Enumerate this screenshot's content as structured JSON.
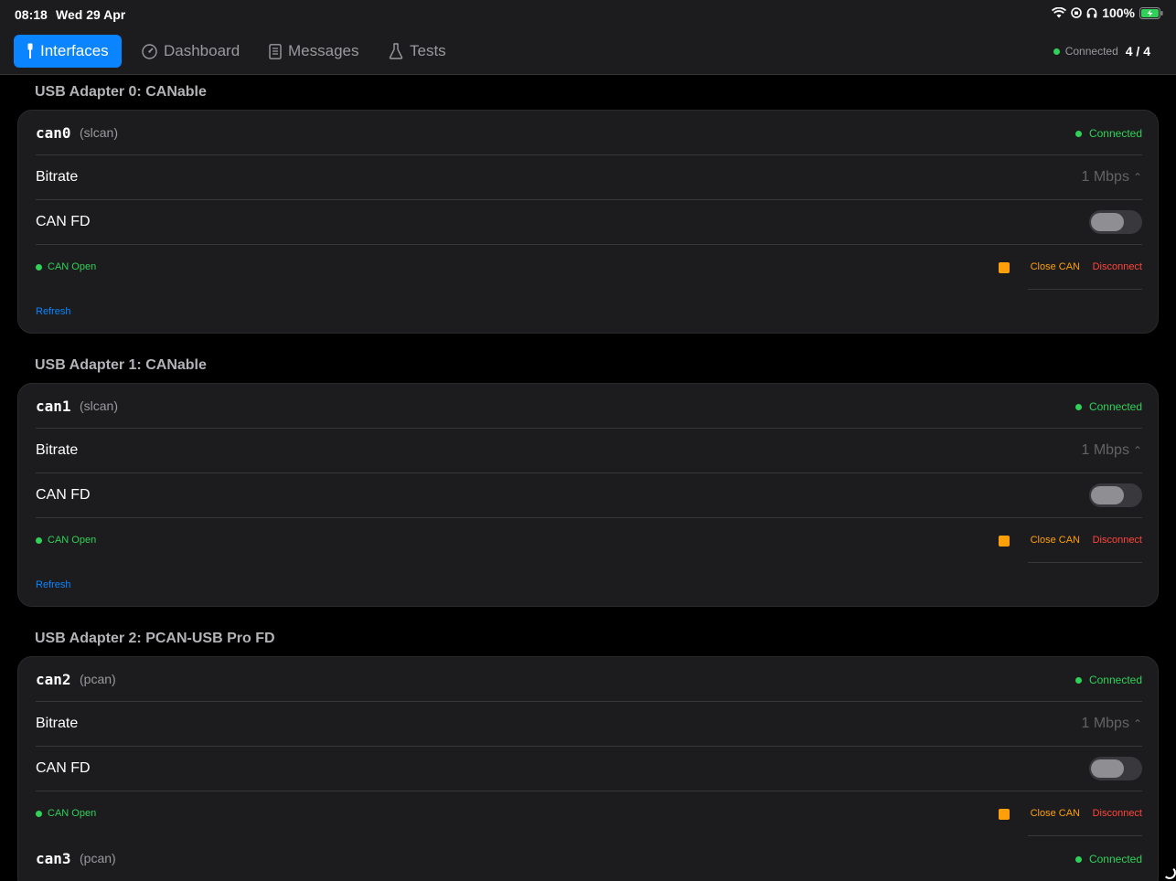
{
  "status_bar": {
    "time": "08:18",
    "date": "Wed 29 Apr",
    "battery": "100%"
  },
  "nav": {
    "tabs": [
      {
        "label": "Interfaces",
        "icon": "usb-plug-icon",
        "active": true
      },
      {
        "label": "Dashboard",
        "icon": "gauge-icon",
        "active": false
      },
      {
        "label": "Messages",
        "icon": "document-icon",
        "active": false
      },
      {
        "label": "Tests",
        "icon": "flask-icon",
        "active": false
      }
    ],
    "connection_label": "Connected",
    "connection_count": "4 / 4"
  },
  "adapters": [
    {
      "title": "USB Adapter 0: CANable",
      "interfaces": [
        {
          "name": "can0",
          "driver": "(slcan)",
          "status": "Connected",
          "bitrate_label": "Bitrate",
          "bitrate": "1 Mbps",
          "canfd_label": "CAN FD",
          "canfd_on": false,
          "open_status": "CAN Open",
          "close_label": "Close CAN",
          "disconnect_label": "Disconnect"
        }
      ],
      "refresh_label": "Refresh"
    },
    {
      "title": "USB Adapter 1: CANable",
      "interfaces": [
        {
          "name": "can1",
          "driver": "(slcan)",
          "status": "Connected",
          "bitrate_label": "Bitrate",
          "bitrate": "1 Mbps",
          "canfd_label": "CAN FD",
          "canfd_on": false,
          "open_status": "CAN Open",
          "close_label": "Close CAN",
          "disconnect_label": "Disconnect"
        }
      ],
      "refresh_label": "Refresh"
    },
    {
      "title": "USB Adapter 2: PCAN-USB Pro FD",
      "interfaces": [
        {
          "name": "can2",
          "driver": "(pcan)",
          "status": "Connected",
          "bitrate_label": "Bitrate",
          "bitrate": "1 Mbps",
          "canfd_label": "CAN FD",
          "canfd_on": false,
          "open_status": "CAN Open",
          "close_label": "Close CAN",
          "disconnect_label": "Disconnect"
        },
        {
          "name": "can3",
          "driver": "(pcan)",
          "status": "Connected"
        }
      ]
    }
  ]
}
